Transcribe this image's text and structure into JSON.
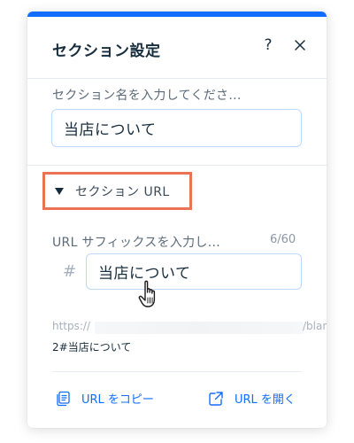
{
  "panel": {
    "title": "セクション設定",
    "help_icon": "?",
    "close_icon": "close-icon"
  },
  "section_name": {
    "label": "セクション名を入力してくださ...",
    "value": "当店について"
  },
  "url_section": {
    "toggle_label": "セクション URL",
    "expanded": true,
    "suffix_label": "URL サフィックスを入力し...",
    "char_count": "6/60",
    "prefix": "#",
    "suffix_value": "当店について",
    "preview_start": "https://",
    "preview_end": "/blan",
    "preview_path": "2#当店について"
  },
  "footer": {
    "copy_label": "URL をコピー",
    "copy_icon": "copy-icon",
    "open_label": "URL を開く",
    "open_icon": "external-link-icon"
  },
  "colors": {
    "accent": "#116dff",
    "highlight_border": "#ec7254",
    "text_primary": "#162d3d",
    "text_secondary": "#5c6b7a"
  }
}
